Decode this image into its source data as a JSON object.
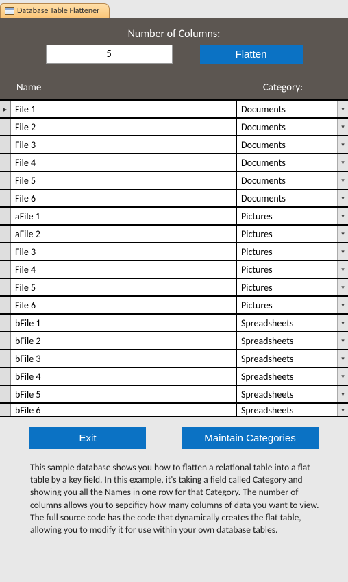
{
  "tab": {
    "title": "Database Table Flattener"
  },
  "header": {
    "columns_label": "Number of Columns:",
    "columns_value": "5",
    "flatten_label": "Flatten",
    "name_header": "Name",
    "category_header": "Category:"
  },
  "rows": [
    {
      "name": "File 1",
      "category": "Documents",
      "selected": true
    },
    {
      "name": "File 2",
      "category": "Documents",
      "selected": false
    },
    {
      "name": "File 3",
      "category": "Documents",
      "selected": false
    },
    {
      "name": "File 4",
      "category": "Documents",
      "selected": false
    },
    {
      "name": "File 5",
      "category": "Documents",
      "selected": false
    },
    {
      "name": "File 6",
      "category": "Documents",
      "selected": false
    },
    {
      "name": "aFile 1",
      "category": "Pictures",
      "selected": false
    },
    {
      "name": "aFile 2",
      "category": "Pictures",
      "selected": false
    },
    {
      "name": "File 3",
      "category": "Pictures",
      "selected": false
    },
    {
      "name": "File 4",
      "category": "Pictures",
      "selected": false
    },
    {
      "name": "File 5",
      "category": "Pictures",
      "selected": false
    },
    {
      "name": "File 6",
      "category": "Pictures",
      "selected": false
    },
    {
      "name": "bFile 1",
      "category": "Spreadsheets",
      "selected": false
    },
    {
      "name": "bFile 2",
      "category": "Spreadsheets",
      "selected": false
    },
    {
      "name": "bFile 3",
      "category": "Spreadsheets",
      "selected": false
    },
    {
      "name": "bFile 4",
      "category": "Spreadsheets",
      "selected": false
    },
    {
      "name": "bFile 5",
      "category": "Spreadsheets",
      "selected": false
    },
    {
      "name": "bFile 6",
      "category": "Spreadsheets",
      "selected": false
    }
  ],
  "footer": {
    "exit_label": "Exit",
    "maintain_label": "Maintain Categories",
    "description": "This sample database shows you how to flatten a relational table into a flat table by a key field.  In this example, it's taking a field called Category and showing you all the Names in one row for that Category.  The number of columns allows you to sepcificy how many columns of data you want to view.  The full source code has the code that dynamically creates the flat table, allowing you to modify it for use within your own database tables."
  },
  "icons": {
    "dropdown_glyph": "▾",
    "record_glyph": "▸"
  }
}
